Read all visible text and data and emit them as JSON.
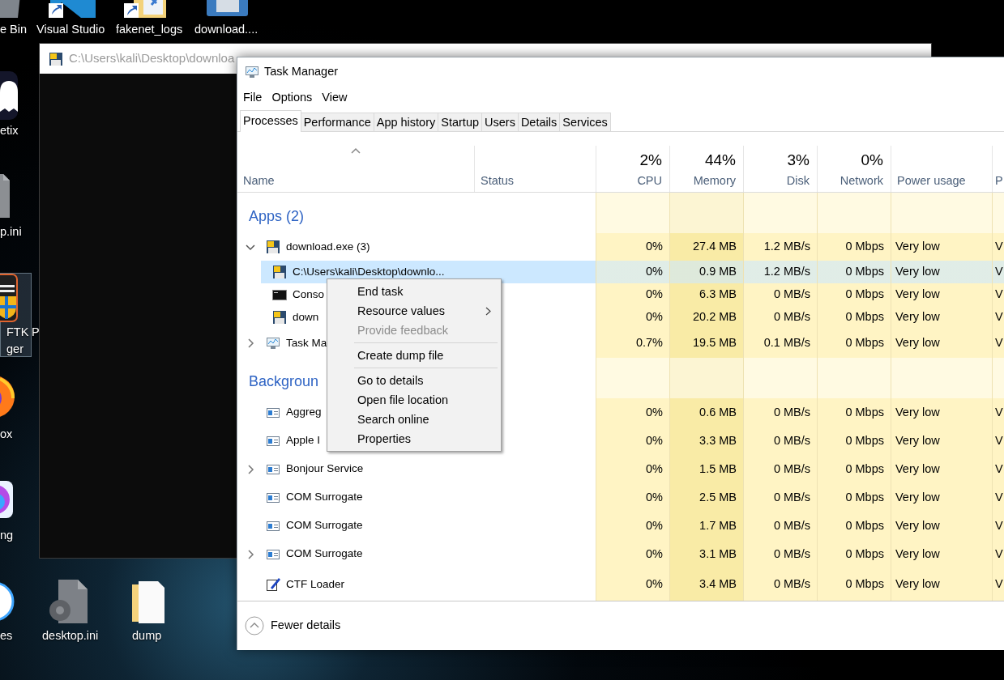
{
  "desktop_icons": [
    {
      "kind": "bin",
      "selected": false,
      "lines": [
        "e Bin"
      ]
    },
    {
      "kind": "editor-shortcut",
      "selected": false,
      "lines": [
        "Visual Studio"
      ]
    },
    {
      "kind": "folder-shortcut",
      "selected": false,
      "lines": [
        "fakenet_logs"
      ]
    },
    {
      "kind": "disk",
      "selected": false,
      "lines": [
        "download...."
      ]
    },
    {
      "kind": "ghost",
      "selected": false,
      "lines": [
        "etix"
      ]
    },
    {
      "kind": "file",
      "selected": false,
      "lines": [
        "p.ini"
      ]
    },
    {
      "kind": "shield",
      "selected": true,
      "lines": [
        "FTK",
        "ger"
      ]
    },
    {
      "kind": "none",
      "selected": false,
      "lines": [
        "P"
      ]
    },
    {
      "kind": "fox",
      "selected": false,
      "lines": [
        "ox"
      ]
    },
    {
      "kind": "gradient",
      "selected": false,
      "lines": [
        "ng"
      ]
    },
    {
      "kind": "music",
      "selected": false,
      "lines": [
        "es"
      ]
    },
    {
      "kind": "gear-file",
      "selected": false,
      "lines": [
        "desktop.ini"
      ]
    },
    {
      "kind": "folder",
      "selected": false,
      "lines": [
        "dump"
      ]
    }
  ],
  "console_window": {
    "title": "C:\\Users\\kali\\Desktop\\downloa"
  },
  "task_manager": {
    "title": "Task Manager",
    "menu": [
      "File",
      "Options",
      "View"
    ],
    "tabs": [
      {
        "label": "Processes",
        "selected": true
      },
      {
        "label": "Performance",
        "selected": false
      },
      {
        "label": "App history",
        "selected": false
      },
      {
        "label": "Startup",
        "selected": false
      },
      {
        "label": "Users",
        "selected": false
      },
      {
        "label": "Details",
        "selected": false
      },
      {
        "label": "Services",
        "selected": false
      }
    ],
    "columns": [
      {
        "kind": "name",
        "label": "Name",
        "sorted": true
      },
      {
        "kind": "status",
        "label": "Status"
      },
      {
        "kind": "metric",
        "total": "2%",
        "label": "CPU",
        "color": "#fff4c4"
      },
      {
        "kind": "metric",
        "total": "44%",
        "label": "Memory",
        "color": "#f9eba6"
      },
      {
        "kind": "metric",
        "total": "3%",
        "label": "Disk",
        "color": "#fff4c4"
      },
      {
        "kind": "metric",
        "total": "0%",
        "label": "Network",
        "color": "#fff4c4"
      },
      {
        "kind": "rating",
        "label": "Power usage",
        "color": "#fff4c4"
      },
      {
        "kind": "rating",
        "label": "P",
        "color": "#fff4c4"
      }
    ],
    "rows": [
      {
        "kind": "group",
        "label": "Apps (2)"
      },
      {
        "kind": "app",
        "name": "download.exe (3)",
        "expanded": true,
        "selected": false,
        "values": [
          "0%",
          "27.4 MB",
          "1.2 MB/s",
          "0 Mbps",
          "Very low",
          "V"
        ],
        "children": [
          {
            "kind": "app",
            "name": "C:\\Users\\kali\\Desktop\\downlo...",
            "selected": true,
            "values": [
              "0%",
              "0.9 MB",
              "1.2 MB/s",
              "0 Mbps",
              "Very low",
              "V"
            ]
          },
          {
            "kind": "console",
            "name": "Conso",
            "selected": false,
            "values": [
              "0%",
              "6.3 MB",
              "0 MB/s",
              "0 Mbps",
              "Very low",
              "V"
            ]
          },
          {
            "kind": "app",
            "name": "down",
            "selected": false,
            "values": [
              "0%",
              "20.2 MB",
              "0 MB/s",
              "0 Mbps",
              "Very low",
              "V"
            ]
          }
        ]
      },
      {
        "kind": "monitor",
        "name": "Task Ma",
        "expanded": false,
        "selected": false,
        "values": [
          "0.7%",
          "19.5 MB",
          "0.1 MB/s",
          "0 Mbps",
          "Very low",
          "V"
        ]
      },
      {
        "kind": "group",
        "label": "Backgroun"
      },
      {
        "kind": "service",
        "name": "Aggreg",
        "selected": false,
        "values": [
          "0%",
          "0.6 MB",
          "0 MB/s",
          "0 Mbps",
          "Very low",
          "V"
        ]
      },
      {
        "kind": "service",
        "name": "Apple I",
        "selected": false,
        "values": [
          "0%",
          "3.3 MB",
          "0 MB/s",
          "0 Mbps",
          "Very low",
          "V"
        ]
      },
      {
        "kind": "service",
        "name": "Bonjour Service",
        "expanded": false,
        "selected": false,
        "values": [
          "0%",
          "1.5 MB",
          "0 MB/s",
          "0 Mbps",
          "Very low",
          "V"
        ]
      },
      {
        "kind": "service",
        "name": "COM Surrogate",
        "selected": false,
        "values": [
          "0%",
          "2.5 MB",
          "0 MB/s",
          "0 Mbps",
          "Very low",
          "V"
        ]
      },
      {
        "kind": "service",
        "name": "COM Surrogate",
        "selected": false,
        "values": [
          "0%",
          "1.7 MB",
          "0 MB/s",
          "0 Mbps",
          "Very low",
          "V"
        ]
      },
      {
        "kind": "service",
        "name": "COM Surrogate",
        "expanded": false,
        "selected": false,
        "values": [
          "0%",
          "3.1 MB",
          "0 MB/s",
          "0 Mbps",
          "Very low",
          "V"
        ]
      },
      {
        "kind": "editor",
        "name": "CTF Loader",
        "selected": false,
        "values": [
          "0%",
          "3.4 MB",
          "0 MB/s",
          "0 Mbps",
          "Very low",
          "V"
        ]
      }
    ],
    "context_menu": [
      {
        "kind": "item",
        "label": "End task",
        "disabled": false
      },
      {
        "kind": "submenu",
        "label": "Resource values",
        "disabled": false
      },
      {
        "kind": "item",
        "label": "Provide feedback",
        "disabled": true
      },
      {
        "kind": "separator"
      },
      {
        "kind": "item",
        "label": "Create dump file",
        "disabled": false
      },
      {
        "kind": "separator"
      },
      {
        "kind": "item",
        "label": "Go to details",
        "disabled": false
      },
      {
        "kind": "item",
        "label": "Open file location",
        "disabled": false
      },
      {
        "kind": "item",
        "label": "Search online",
        "disabled": false
      },
      {
        "kind": "item",
        "label": "Properties",
        "disabled": false
      }
    ],
    "footer": {
      "label": "Fewer details"
    }
  }
}
